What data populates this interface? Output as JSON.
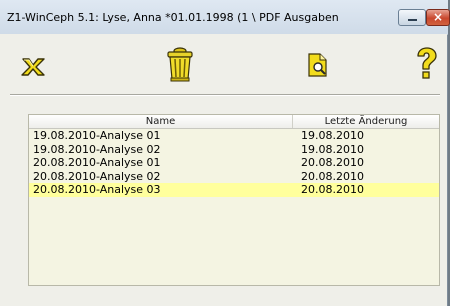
{
  "window": {
    "title": "Z1-WinCeph 5.1: Lyse, Anna *01.01.1998 (1 \\ PDF Ausgaben",
    "close_glyph": "×"
  },
  "toolbar": {
    "tools": [
      {
        "name": "cancel",
        "icon": "yellow-x-icon"
      },
      {
        "name": "delete",
        "icon": "trash-can-icon"
      },
      {
        "name": "preview",
        "icon": "document-magnifier-icon"
      },
      {
        "name": "help",
        "icon": "question-mark-icon"
      }
    ]
  },
  "list": {
    "columns": {
      "name": "Name",
      "date": "Letzte Änderung"
    },
    "rows": [
      {
        "name": "19.08.2010-Analyse 01",
        "date": "19.08.2010",
        "selected": false
      },
      {
        "name": "19.08.2010-Analyse 02",
        "date": "19.08.2010",
        "selected": false
      },
      {
        "name": "20.08.2010-Analyse 01",
        "date": "20.08.2010",
        "selected": false
      },
      {
        "name": "20.08.2010-Analyse 02",
        "date": "20.08.2010",
        "selected": false
      },
      {
        "name": "20.08.2010-Analyse 03",
        "date": "20.08.2010",
        "selected": true
      }
    ]
  },
  "colors": {
    "selection": "#ffff9c",
    "list_background": "#f4f4e2",
    "icon_yellow": "#f2dc1c"
  }
}
